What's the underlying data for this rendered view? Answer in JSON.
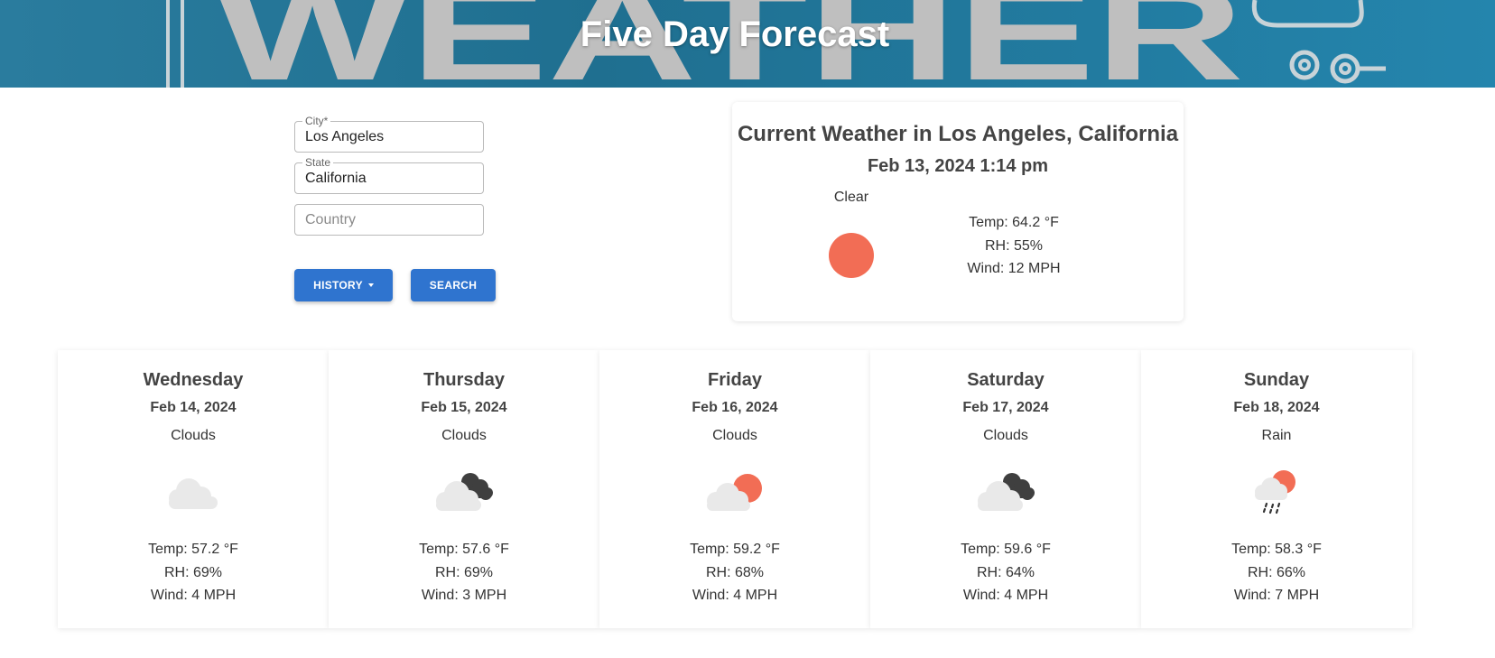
{
  "header": {
    "title": "Five Day Forecast",
    "background_word": "WEATHER"
  },
  "search": {
    "city": {
      "label": "City*",
      "value": "Los Angeles"
    },
    "state": {
      "label": "State",
      "value": "California"
    },
    "country": {
      "placeholder": "Country",
      "value": ""
    },
    "history_label": "HISTORY",
    "search_label": "SEARCH"
  },
  "current": {
    "title": "Current Weather in Los Angeles, California",
    "datetime": "Feb 13, 2024 1:14 pm",
    "condition": "Clear",
    "icon": "sun-icon",
    "temp": "Temp: 64.2 °F",
    "rh": "RH: 55%",
    "wind": "Wind: 12 MPH"
  },
  "forecast": [
    {
      "day": "Wednesday",
      "date": "Feb 14, 2024",
      "condition": "Clouds",
      "icon": "cloud-icon",
      "temp": "Temp: 57.2 °F",
      "rh": "RH: 69%",
      "wind": "Wind: 4 MPH"
    },
    {
      "day": "Thursday",
      "date": "Feb 15, 2024",
      "condition": "Clouds",
      "icon": "cloud-dark-clouds-icon",
      "temp": "Temp: 57.6 °F",
      "rh": "RH: 69%",
      "wind": "Wind: 3 MPH"
    },
    {
      "day": "Friday",
      "date": "Feb 16, 2024",
      "condition": "Clouds",
      "icon": "cloud-sun-icon",
      "temp": "Temp: 59.2 °F",
      "rh": "RH: 68%",
      "wind": "Wind: 4 MPH"
    },
    {
      "day": "Saturday",
      "date": "Feb 17, 2024",
      "condition": "Clouds",
      "icon": "cloud-dark-clouds-icon",
      "temp": "Temp: 59.6 °F",
      "rh": "RH: 64%",
      "wind": "Wind: 4 MPH"
    },
    {
      "day": "Sunday",
      "date": "Feb 18, 2024",
      "condition": "Rain",
      "icon": "rain-sun-icon",
      "temp": "Temp: 58.3 °F",
      "rh": "RH: 66%",
      "wind": "Wind: 7 MPH"
    }
  ],
  "colors": {
    "banner": "#1f6f90",
    "button": "#2f74cf",
    "sun": "#f26d55",
    "cloud_light": "#e9e9e9",
    "cloud_dark": "#3f3f3f"
  }
}
